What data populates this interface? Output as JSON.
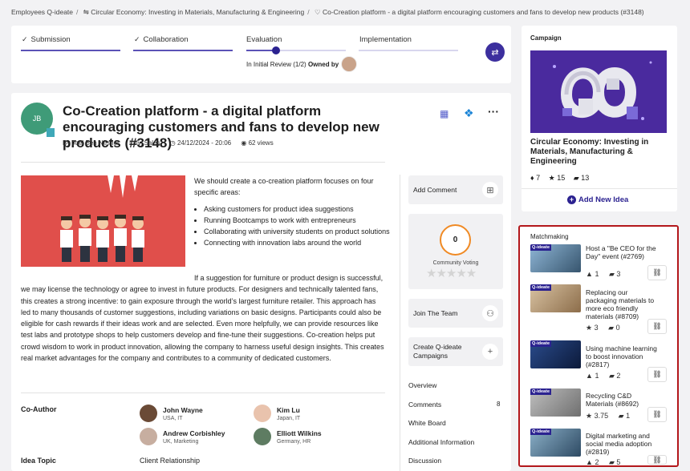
{
  "breadcrumb": {
    "items": [
      "Employees Q-ideate",
      "⇋ Circular Economy: Investing in Materials, Manufacturing & Engineering",
      "♡ Co-Creation platform - a digital platform encouraging customers and fans to develop new products (#3148)"
    ]
  },
  "stages": {
    "items": [
      {
        "label": "Submission",
        "done": true
      },
      {
        "label": "Collaboration",
        "done": true
      },
      {
        "label": "Evaluation",
        "done": false
      },
      {
        "label": "Implementation",
        "done": false
      }
    ],
    "status": "In Initial Review (1/2)",
    "owned_by": "Owned by"
  },
  "idea": {
    "initials": "JB",
    "title": "Co-Creation platform - a digital platform encouraging customers and fans to develop new products (#3148)",
    "author": "By Joel Ben Nesher",
    "location": "Italy, Sales",
    "date": "24/12/2024 - 20:06",
    "views": "62 views",
    "intro": "We should create a co-creation platform focuses on four specific areas:",
    "bullets": [
      "Asking customers for product idea suggestions",
      "Running Bootcamps to work with entrepreneurs",
      "Collaborating with university students on product solutions",
      "Connecting with innovation labs around the world"
    ],
    "paragraph": "If a suggestion for furniture or product design is successful, we may license the technology or agree to invest in future products. For designers and technically talented fans, this creates a strong incentive: to gain exposure through the world’s largest furniture retailer. This approach has led to many thousands of customer suggestions, including variations on basic designs. Participants could also be eligible for cash rewards if their ideas work and are selected. Even more helpfully, we can provide resources like test labs and prototype shops to help customers develop and fine-tune their suggestions. Co-creation helps put crowd wisdom to work in product innovation, allowing the company to harness useful design insights. This creates real market advantages for the company and contributes to a community of dedicated customers."
  },
  "coauthor": {
    "label": "Co-Author",
    "people": [
      {
        "name": "John Wayne",
        "sub": "USA, IT"
      },
      {
        "name": "Kim Lu",
        "sub": "Japan, IT"
      },
      {
        "name": "Andrew Corbishley",
        "sub": "UK, Marketing"
      },
      {
        "name": "Elliott Wilkins",
        "sub": "Germany, HR"
      }
    ]
  },
  "topic": {
    "label": "Idea Topic",
    "value": "Client Relationship"
  },
  "actions": {
    "add_comment": "Add Comment",
    "voting_value": "0",
    "voting_label": "Community Voting",
    "join_team": "Join The Team",
    "create_campaigns": "Create Q-ideate Campaigns"
  },
  "nav": {
    "overview": "Overview",
    "comments": "Comments",
    "comments_count": "8",
    "whiteboard": "White Board",
    "additional": "Additional Information",
    "discussion": "Discussion"
  },
  "campaign": {
    "header": "Campaign",
    "title": "Circular Economy: Investing in Materials, Manufacturing & Engineering",
    "stat1": "7",
    "stat2": "15",
    "stat3": "13",
    "add_new": "Add New Idea"
  },
  "matchmaking": {
    "header": "Matchmaking",
    "tag": "Q-ideate",
    "items": [
      {
        "title": "Host a \"Be CEO for the Day\" event (#2769)",
        "s1": "1",
        "s2": "3"
      },
      {
        "title": "Replacing our packaging materials to more eco friendly materials (#8709)",
        "s1": "3",
        "s2": "0"
      },
      {
        "title": "Using machine learning to boost innovation (#2817)",
        "s1": "1",
        "s2": "2"
      },
      {
        "title": "Recycling C&D Materials (#8692)",
        "s1": "3.75",
        "s2": "1"
      },
      {
        "title": "Digital marketing and social media adoption (#2819)",
        "s1": "2",
        "s2": "5"
      }
    ]
  },
  "colors": {
    "accent": "#3c2f9e",
    "highlight_border": "#b3171b",
    "avatar": "#3f9b78",
    "voting_ring": "#f08a24"
  }
}
